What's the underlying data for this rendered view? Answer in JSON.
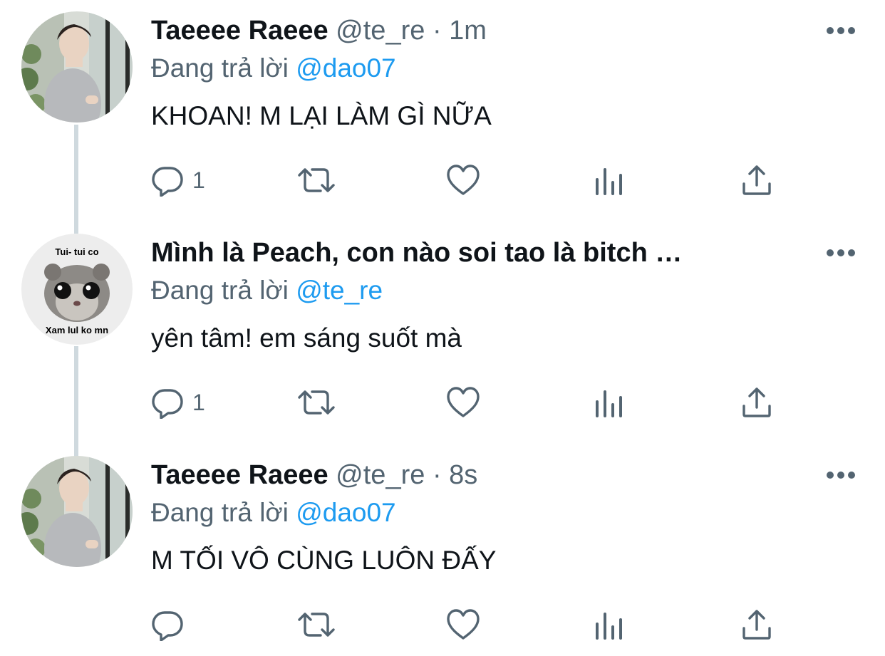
{
  "tweets": [
    {
      "name": "Taeeee Raeee",
      "handle": "@te_re",
      "separator": "·",
      "time": "1m",
      "replying_prefix": "Đang trả lời",
      "replying_to": "@dao07",
      "text": "KHOAN! M LẠI LÀM GÌ NỮA",
      "reply_count": "1",
      "avatar": "person-photo"
    },
    {
      "name": "Mình là Peach, con nào soi tao là bitch …",
      "replying_prefix": "Đang trả lời",
      "replying_to": "@te_re",
      "text": "yên tâm! em sáng suốt mà",
      "reply_count": "1",
      "avatar": "hamster-meme",
      "avatar_text_top": "Tui- tui co",
      "avatar_text_bottom": "Xam lul ko mn"
    },
    {
      "name": "Taeeee Raeee",
      "handle": "@te_re",
      "separator": "·",
      "time": "8s",
      "replying_prefix": "Đang trả lời",
      "replying_to": "@dao07",
      "text": "M TỐI VÔ CÙNG LUÔN ĐẤY",
      "reply_count": "",
      "avatar": "person-photo"
    }
  ],
  "icons": [
    "reply-icon",
    "retweet-icon",
    "like-icon",
    "views-icon",
    "share-icon",
    "more-icon"
  ],
  "colors": {
    "text": "#0f1419",
    "secondary": "#536471",
    "accent": "#1d9bf0",
    "thread_line": "#cfd9de"
  }
}
